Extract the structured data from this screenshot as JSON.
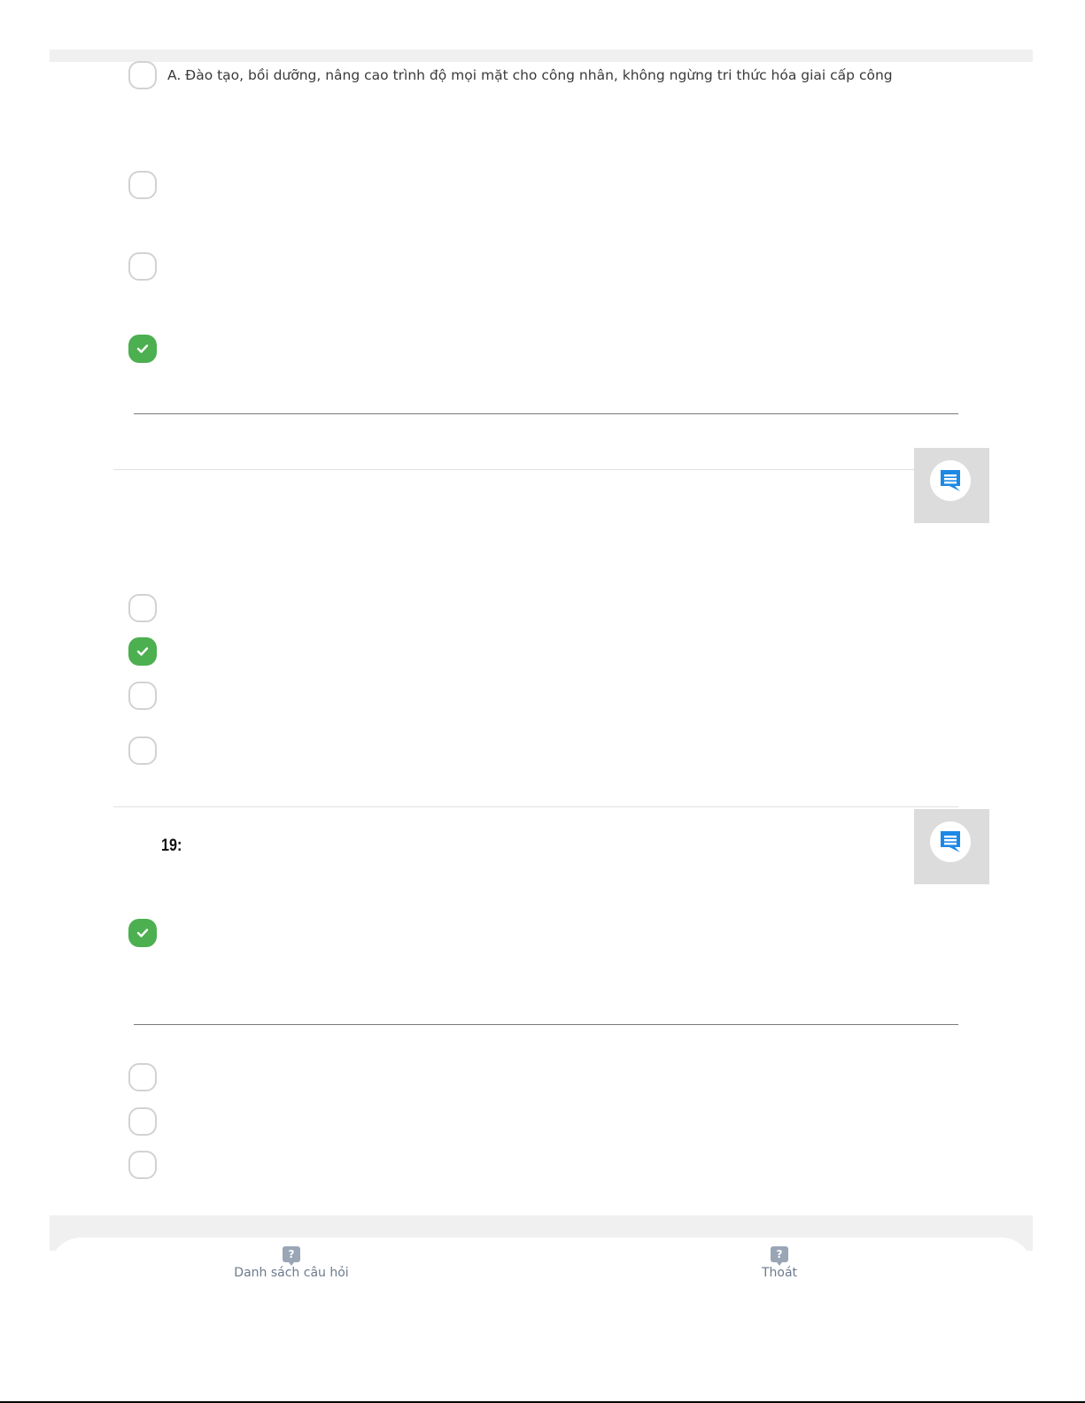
{
  "question_17": {
    "option_a_text": "A. Đào tạo, bồi dưỡng, nâng cao trình độ mọi mặt cho công nhân, không ngừng tri thức hóa giai cấp công"
  },
  "question_19": {
    "number_label": "19:"
  },
  "bottom_nav": {
    "question_list_label": "Danh sách câu hỏi",
    "question_list_icon": "?",
    "exit_label": "Thoát",
    "exit_icon": "?"
  },
  "colors": {
    "checked": "#4caf50",
    "comment_icon": "#1e88e5",
    "nav_icon": "#9aa6b6"
  }
}
